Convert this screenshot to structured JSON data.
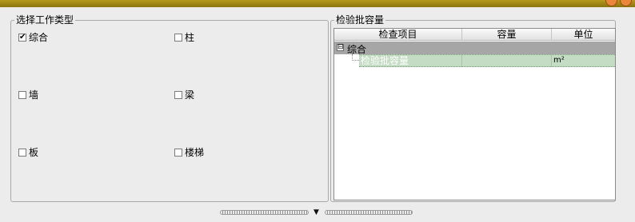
{
  "left_panel": {
    "legend": "选择工作类型",
    "options": [
      {
        "label": "综合",
        "checked": true
      },
      {
        "label": "柱",
        "checked": false
      },
      {
        "label": "墙",
        "checked": false
      },
      {
        "label": "梁",
        "checked": false
      },
      {
        "label": "板",
        "checked": false
      },
      {
        "label": "楼梯",
        "checked": false
      }
    ]
  },
  "right_panel": {
    "legend": "检验批容量",
    "columns": [
      "检查项目",
      "容量",
      "单位"
    ],
    "group_row": {
      "expander": "⊟",
      "label": "综合"
    },
    "rows": [
      {
        "item": "检验批容量",
        "capacity": "",
        "unit": "m²"
      }
    ]
  },
  "check_glyph": "✔"
}
